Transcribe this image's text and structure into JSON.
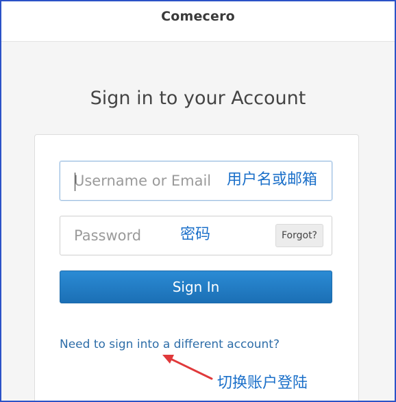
{
  "header": {
    "brand": "Comecero"
  },
  "page": {
    "title": "Sign in to your Account"
  },
  "form": {
    "username_placeholder": "Username or Email",
    "username_value": "",
    "password_placeholder": "Password",
    "password_value": "",
    "forgot_label": "Forgot?",
    "signin_label": "Sign In",
    "switch_account_link": "Need to sign into a different account?"
  },
  "annotations": {
    "username_cn": "用户名或邮箱",
    "password_cn": "密码",
    "switch_account_cn": "切换账户登陆"
  },
  "colors": {
    "accent": "#1f78c1",
    "annotation": "#1a6fc9",
    "arrow": "#e0393b",
    "frame_border": "#2b52c7"
  }
}
